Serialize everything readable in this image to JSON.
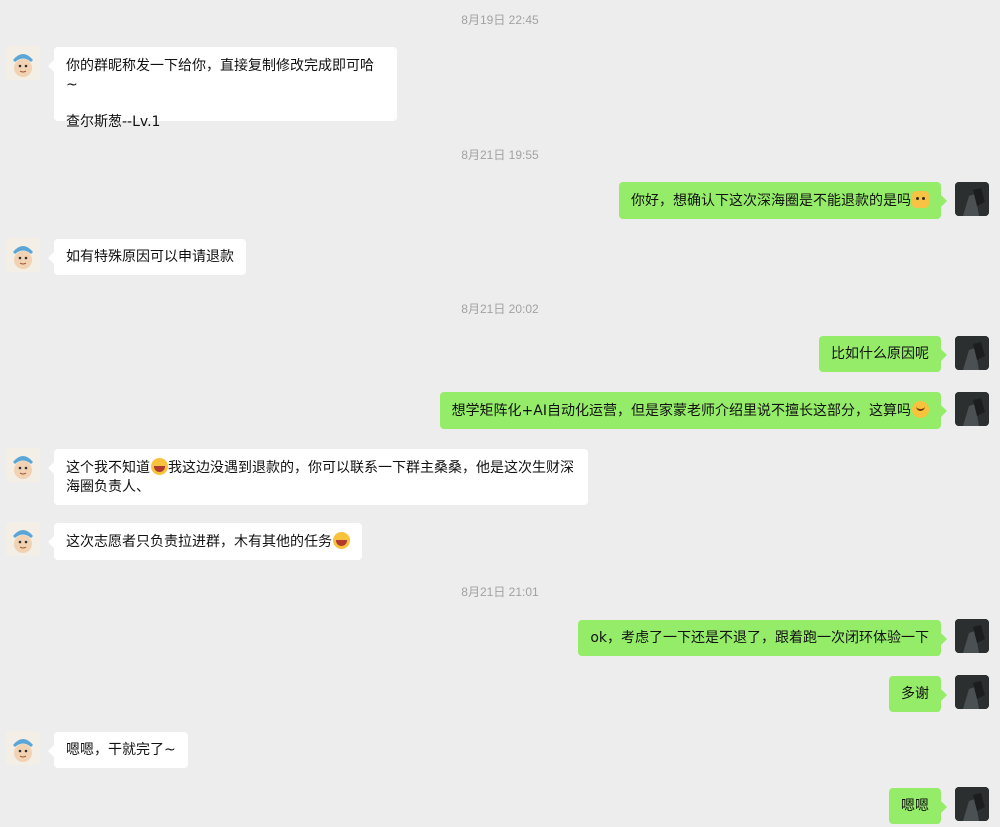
{
  "timestamps": [
    "8月19日 22:45",
    "8月21日 19:55",
    "8月21日 20:02",
    "8月21日 21:01"
  ],
  "messages": [
    {
      "from": "other",
      "line1": "你的群昵称发一下给你，直接复制修改完成即可哈~",
      "line2": "查尔斯葱--Lv.1"
    },
    {
      "from": "me",
      "text": "你好，想确认下这次深海圈是不能退款的是吗",
      "emoji": "cat-face-emoji"
    },
    {
      "from": "other",
      "text": "如有特殊原因可以申请退款"
    },
    {
      "from": "me",
      "text": "比如什么原因呢"
    },
    {
      "from": "me",
      "text": "想学矩阵化+AI自动化运营，但是家蒙老师介绍里说不擅长这部分，这算吗",
      "emoji": "upside-down-face-emoji"
    },
    {
      "from": "other",
      "part1": "这个我不知道",
      "part2": "我这边没遇到退款的，你可以联系一下群主桑桑，他是这次生财深",
      "line2": "海圈负责人、",
      "emoji": "laughing-emoji"
    },
    {
      "from": "other",
      "text": "这次志愿者只负责拉进群，木有其他的任务",
      "emoji": "laughing-emoji"
    },
    {
      "from": "me",
      "text": "ok，考虑了一下还是不退了，跟着跑一次闭环体验一下"
    },
    {
      "from": "me",
      "text": "多谢"
    },
    {
      "from": "other",
      "text": "嗯嗯，干就完了~"
    },
    {
      "from": "me",
      "text": "嗯嗯"
    }
  ],
  "colors": {
    "background": "#ededed",
    "my_bubble": "#95ec69",
    "other_bubble": "#ffffff",
    "timestamp": "#a2a2a2"
  }
}
